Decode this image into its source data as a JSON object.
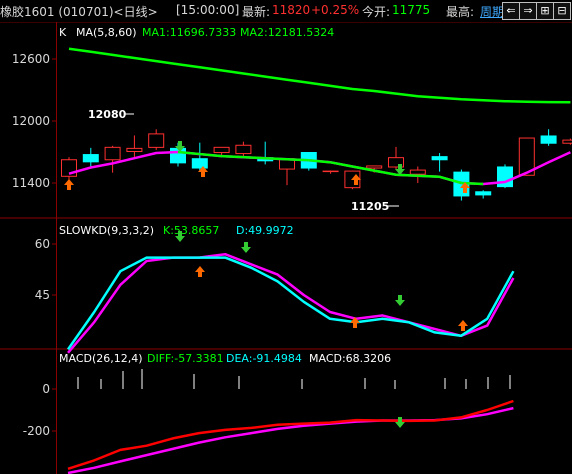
{
  "header": {
    "symbol": "橡胶1601 (010701)<日线>",
    "time": "[15:00:00]",
    "latest_label": "最新:",
    "latest_value": "11820",
    "change_pct": "+0.25%",
    "open_label": "今开:",
    "open_value": "11775",
    "high_label": "最高:",
    "period_link": "周期"
  },
  "nav_icons": [
    "arrow-left-icon",
    "arrow-right-icon",
    "zoom-in-icon",
    "zoom-out-icon"
  ],
  "colors": {
    "up": "#ff3030",
    "down": "#00ffff",
    "ma1": "#ff00ff",
    "ma2": "#00ff00",
    "k_line": "#00ffff",
    "d_line": "#ff00ff",
    "diff": "#ff0000",
    "dea": "#ff00ff",
    "panel_border": "#8b0000",
    "grid": "#5a0000",
    "header_period": "#3fa9ff"
  },
  "kline_panel": {
    "label": "K",
    "indicator": "MA(5,8,60)",
    "ma1_label": "MA1:11696.7333",
    "ma2_label": "MA2:12181.5324",
    "axis_ticks": [
      "12600",
      "12000",
      "11400"
    ],
    "high_annotation": "12080",
    "low_annotation": "11205"
  },
  "kd_panel": {
    "indicator": "SLOWKD(9,3,3,2)",
    "k_label": "K:53.8657",
    "d_label": "D:49.9972",
    "axis_ticks": [
      "60",
      "45"
    ]
  },
  "macd_panel": {
    "indicator": "MACD(26,12,4)",
    "diff_label": "DIFF:-57.3381",
    "dea_label": "DEA:-91.4984",
    "macd_label": "MACD:68.3206",
    "axis_ticks": [
      "0",
      "-200"
    ]
  },
  "chart_data": [
    {
      "type": "candlestick",
      "title": "K MA(5,8,60)",
      "y_ticks": [
        12600,
        12000,
        11400
      ],
      "candles": [
        {
          "open": 11460,
          "close": 11630,
          "high": 11650,
          "low": 11420,
          "color": "up"
        },
        {
          "open": 11680,
          "close": 11600,
          "high": 11740,
          "low": 11560,
          "color": "down"
        },
        {
          "open": 11620,
          "close": 11750,
          "high": 11760,
          "low": 11500,
          "color": "up"
        },
        {
          "open": 11700,
          "close": 11740,
          "high": 11860,
          "low": 11650,
          "color": "up"
        },
        {
          "open": 11880,
          "close": 11740,
          "high": 11920,
          "low": 11720,
          "color": "up"
        },
        {
          "open": 11740,
          "close": 11590,
          "high": 11790,
          "low": 11560,
          "color": "down"
        },
        {
          "open": 11540,
          "close": 11640,
          "high": 11790,
          "low": 11520,
          "color": "down"
        },
        {
          "open": 11750,
          "close": 11690,
          "high": 11720,
          "low": 11650,
          "color": "up"
        },
        {
          "open": 11770,
          "close": 11680,
          "high": 11800,
          "low": 11650,
          "color": "up"
        },
        {
          "open": 11650,
          "close": 11610,
          "high": 11800,
          "low": 11580,
          "color": "down"
        },
        {
          "open": 11640,
          "close": 11530,
          "high": 11640,
          "low": 11380,
          "color": "up"
        },
        {
          "open": 11540,
          "close": 11700,
          "high": 11700,
          "low": 11520,
          "color": "down"
        },
        {
          "open": 11510,
          "close": 11520,
          "high": 11520,
          "low": 11490,
          "color": "up"
        },
        {
          "open": 11520,
          "close": 11350,
          "high": 11520,
          "low": 11340,
          "color": "up"
        },
        {
          "open": 11570,
          "close": 11540,
          "high": 11570,
          "low": 11500,
          "color": "up"
        },
        {
          "open": 11650,
          "close": 11550,
          "high": 11750,
          "low": 11530,
          "color": "up"
        },
        {
          "open": 11480,
          "close": 11530,
          "high": 11560,
          "low": 11400,
          "color": "up"
        },
        {
          "open": 11620,
          "close": 11660,
          "high": 11690,
          "low": 11510,
          "color": "down"
        },
        {
          "open": 11510,
          "close": 11270,
          "high": 11530,
          "low": 11230,
          "color": "down"
        },
        {
          "open": 11280,
          "close": 11320,
          "high": 11330,
          "low": 11250,
          "color": "down"
        },
        {
          "open": 11360,
          "close": 11560,
          "high": 11580,
          "low": 11350,
          "color": "down"
        },
        {
          "open": 11470,
          "close": 11840,
          "high": 11840,
          "low": 11470,
          "color": "up"
        },
        {
          "open": 11780,
          "close": 11860,
          "high": 11920,
          "low": 11760,
          "color": "down"
        },
        {
          "open": 11780,
          "close": 11820,
          "high": 11830,
          "low": 11770,
          "color": "up"
        }
      ],
      "ma1": [
        11490,
        11550,
        11590,
        11640,
        11690,
        11700,
        11680,
        11660,
        11650,
        11640,
        11630,
        11620,
        11600,
        11560,
        11520,
        11480,
        11470,
        11460,
        11400,
        11390,
        11410,
        11500,
        11600,
        11697
      ],
      "ma2": [
        12700,
        12670,
        12640,
        12610,
        12580,
        12550,
        12520,
        12490,
        12460,
        12430,
        12400,
        12370,
        12340,
        12310,
        12290,
        12265,
        12240,
        12225,
        12210,
        12200,
        12192,
        12187,
        12183,
        12181
      ]
    },
    {
      "type": "line",
      "title": "SLOWKD(9,3,3,2)",
      "y_ticks": [
        60,
        45
      ],
      "series": [
        {
          "name": "K",
          "values": [
            29,
            40,
            52,
            56,
            56,
            56,
            56,
            53,
            49,
            43,
            38,
            37,
            38,
            37,
            34,
            33,
            38,
            52
          ]
        },
        {
          "name": "D",
          "values": [
            28,
            37,
            48,
            55,
            56,
            56,
            57,
            54,
            51,
            45,
            40,
            38,
            39,
            37,
            35,
            33,
            36,
            50
          ]
        }
      ]
    },
    {
      "type": "line",
      "title": "MACD(26,12,4)",
      "y_ticks": [
        0,
        -200
      ],
      "series": [
        {
          "name": "DIFF",
          "values": [
            -380,
            -340,
            -290,
            -270,
            -235,
            -210,
            -195,
            -185,
            -170,
            -165,
            -160,
            -148,
            -150,
            -152,
            -150,
            -135,
            -100,
            -57
          ]
        },
        {
          "name": "DEA",
          "values": [
            -400,
            -375,
            -345,
            -315,
            -285,
            -255,
            -230,
            -210,
            -190,
            -175,
            -165,
            -155,
            -150,
            -150,
            -148,
            -140,
            -120,
            -91
          ]
        }
      ]
    }
  ]
}
